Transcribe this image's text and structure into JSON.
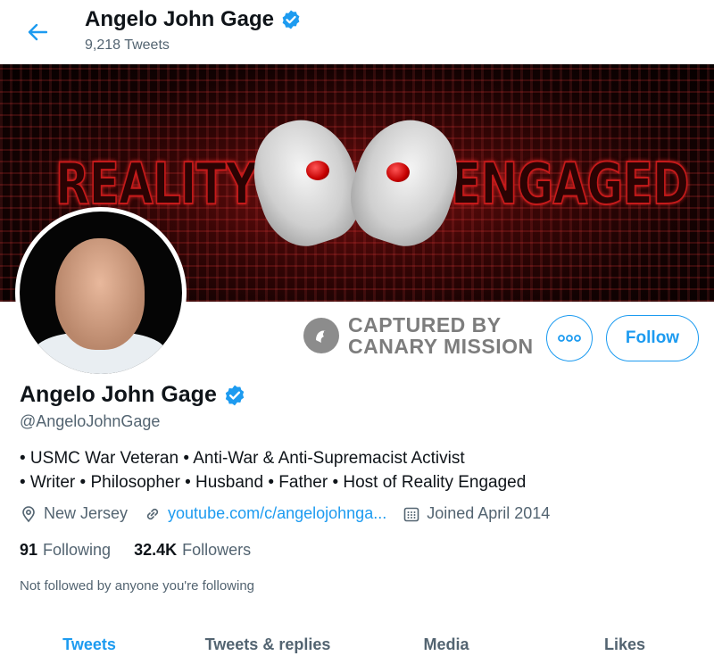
{
  "header": {
    "title": "Angelo John Gage",
    "tweet_count": "9,218 Tweets",
    "back_icon": "arrow-left-icon"
  },
  "banner": {
    "left_word": "REALITY",
    "right_word": "ENGAGED"
  },
  "watermark": {
    "line1": "CAPTURED BY",
    "line2": "CANARY MISSION"
  },
  "actions": {
    "more_label": "ooo",
    "follow_label": "Follow"
  },
  "profile": {
    "name": "Angelo John Gage",
    "handle": "@AngeloJohnGage",
    "bio_line1": "• USMC War Veteran • Anti-War & Anti-Supremacist Activist",
    "bio_line2": "• Writer • Philosopher • Husband • Father • Host of Reality Engaged",
    "location": "New Jersey",
    "website": "youtube.com/c/angelojohnga...",
    "joined": "Joined April 2014"
  },
  "stats": {
    "following_count": "91",
    "following_label": "Following",
    "followers_count": "32.4K",
    "followers_label": "Followers"
  },
  "not_followed": "Not followed by anyone you're following",
  "tabs": [
    {
      "label": "Tweets",
      "active": true
    },
    {
      "label": "Tweets & replies",
      "active": false
    },
    {
      "label": "Media",
      "active": false
    },
    {
      "label": "Likes",
      "active": false
    }
  ],
  "colors": {
    "accent": "#1d9bf0",
    "secondary_text": "#536471",
    "primary_text": "#0f1419"
  }
}
